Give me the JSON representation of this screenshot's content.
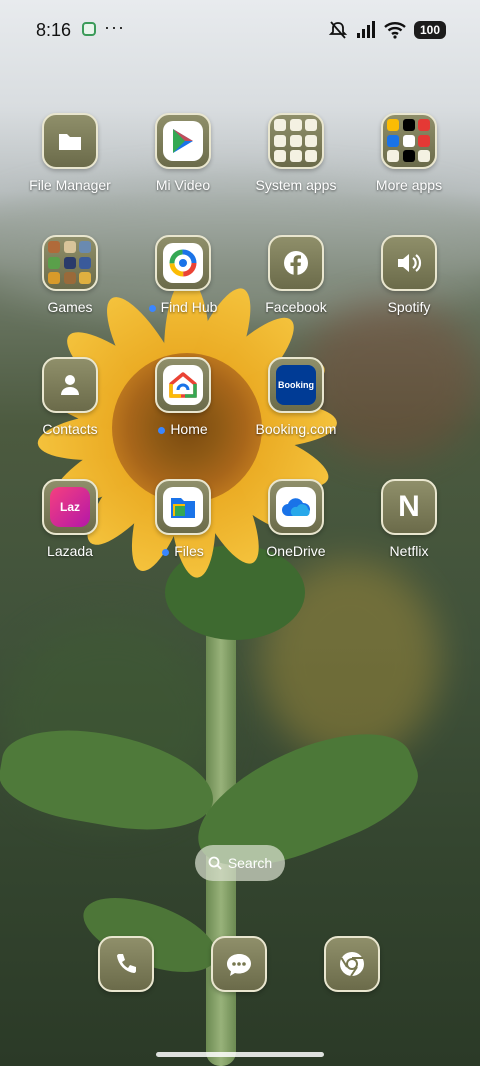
{
  "status_bar": {
    "time": "8:16",
    "dots": "···",
    "battery": "100"
  },
  "apps": {
    "file_manager": "File Manager",
    "mi_video": "Mi Video",
    "system_apps": "System apps",
    "more_apps": "More apps",
    "games": "Games",
    "find_hub": "Find Hub",
    "facebook": "Facebook",
    "spotify": "Spotify",
    "contacts": "Contacts",
    "home": "Home",
    "booking": "Booking.com",
    "lazada": "Lazada",
    "files": "Files",
    "onedrive": "OneDrive",
    "netflix": "Netflix"
  },
  "icon_text": {
    "booking": "Booking",
    "lazada": "Laz",
    "netflix": "N"
  },
  "search": {
    "label": "Search"
  }
}
